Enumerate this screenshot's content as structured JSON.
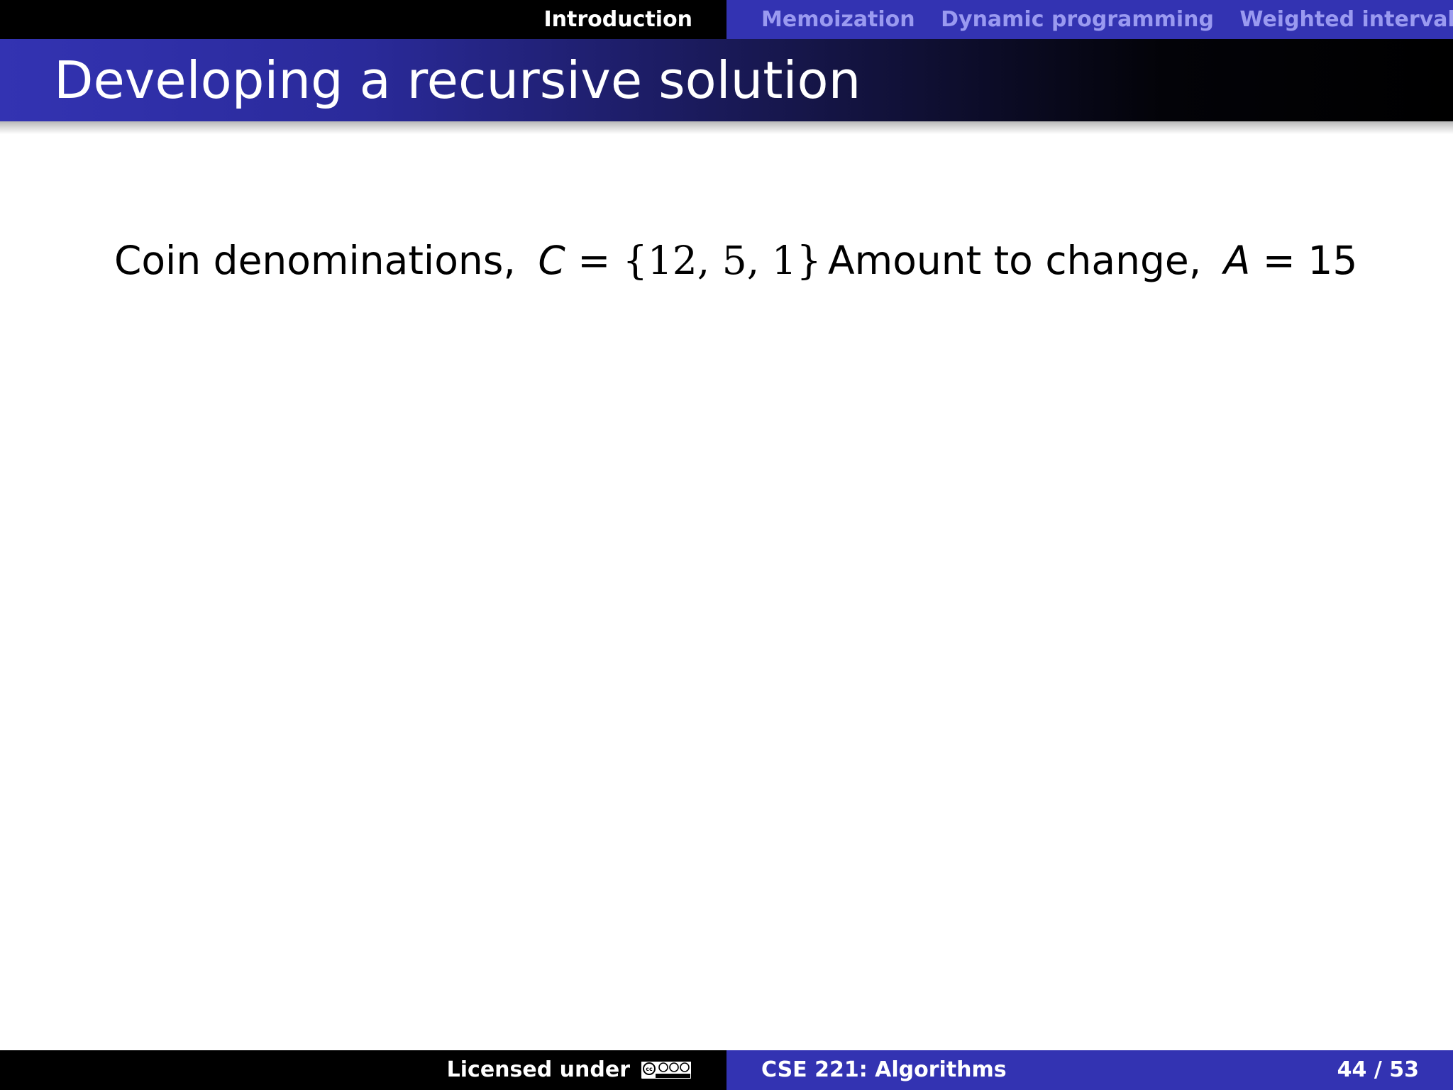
{
  "nav": {
    "current": "Introduction",
    "sections": [
      "Memoization",
      "Dynamic programming",
      "Weighted interval sched"
    ]
  },
  "slide": {
    "title": "Developing a recursive solution"
  },
  "content": {
    "coins_label": "Coin denominations,",
    "coins_var": "C",
    "coins_expr": " = {12, 5, 1}",
    "amount_label": "Amount to change,",
    "amount_var": "A",
    "amount_expr": " = 15"
  },
  "footer": {
    "license_label": "Licensed under",
    "course": "CSE 221: Algorithms",
    "page_current": "44",
    "page_total": "53",
    "page_separator": " / "
  },
  "colors": {
    "theme_blue": "#3333b2",
    "nav_inactive": "#9a9af0"
  }
}
